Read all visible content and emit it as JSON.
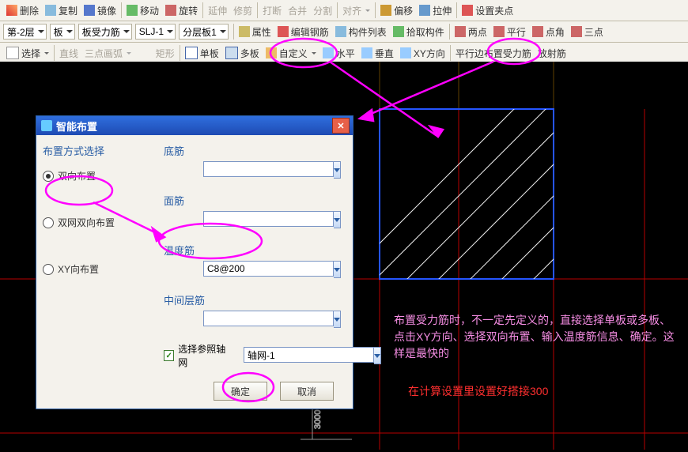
{
  "toolbar1": {
    "delete": "删除",
    "copy": "复制",
    "mirror": "镜像",
    "move": "移动",
    "rotate": "旋转",
    "extend": "延伸",
    "trim": "修剪",
    "break": "打断",
    "merge": "合并",
    "split": "分割",
    "align": "对齐",
    "offset": "偏移",
    "stretch": "拉伸",
    "grip": "设置夹点"
  },
  "toolbar2": {
    "layer": "第-2层",
    "board": "板",
    "rebar": "板受力筋",
    "slj": "SLJ-1",
    "layerboard": "分层板1",
    "prop": "属性",
    "editrebar": "编辑钢筋",
    "members": "构件列表",
    "pick": "拾取构件",
    "twopt": "两点",
    "parallel": "平行",
    "angle": "点角",
    "threept": "三点"
  },
  "toolbar3": {
    "select": "选择",
    "line": "直线",
    "arc": "三点画弧",
    "rect": "矩形",
    "single": "单板",
    "multi": "多板",
    "custom": "自定义",
    "horiz": "水平",
    "vert": "垂直",
    "xydir": "XY方向",
    "paraedge": "平行边布置受力筋",
    "radial": "放射筋"
  },
  "dialog": {
    "title": "智能布置",
    "group": "布置方式选择",
    "opt1": "双向布置",
    "opt2": "双网双向布置",
    "opt3": "XY向布置",
    "f1": "底筋",
    "f2": "面筋",
    "f3": "温度筋",
    "f4": "中间层筋",
    "temp_val": "C8@200",
    "chk": "选择参照轴网",
    "axisnet": "轴网-1",
    "ok": "确定",
    "cancel": "取消"
  },
  "note1": "布置受力筋时，不一定先定义的，直接选择单板或多板、点击XY方向、选择双向布置、输入温度筋信息、确定。这样是最快的",
  "note2": "在计算设置里设置好搭接300",
  "dims": {
    "h": "3000"
  }
}
